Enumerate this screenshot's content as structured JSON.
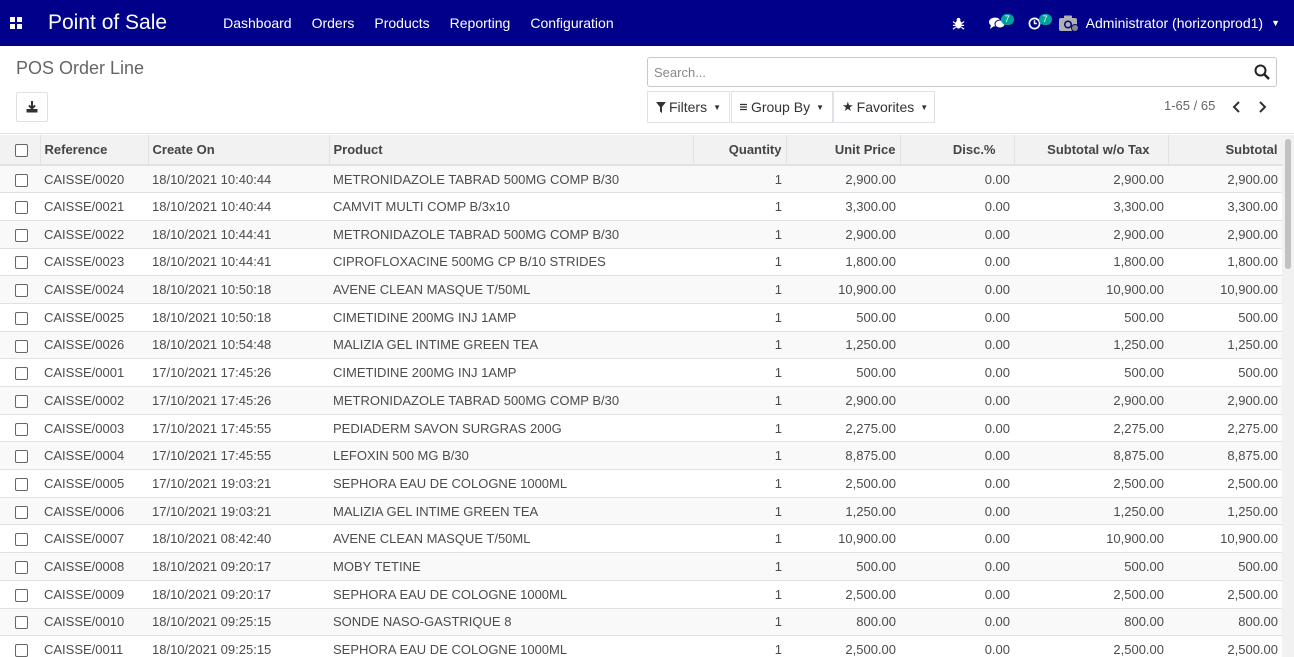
{
  "navbar": {
    "brand": "Point of Sale",
    "menu": [
      "Dashboard",
      "Orders",
      "Products",
      "Reporting",
      "Configuration"
    ],
    "messages_count": "7",
    "activities_count": "7",
    "user": "Administrator (horizonprod1)"
  },
  "control_panel": {
    "title": "POS Order Line",
    "search_placeholder": "Search...",
    "filters_label": "Filters",
    "groupby_label": "Group By",
    "favorites_label": "Favorites",
    "pager": "1-65 / 65"
  },
  "table": {
    "columns": [
      "Reference",
      "Create On",
      "Product",
      "Quantity",
      "Unit Price",
      "Disc.%",
      "Subtotal w/o Tax",
      "Subtotal"
    ],
    "rows": [
      [
        "CAISSE/0020",
        "18/10/2021 10:40:44",
        "METRONIDAZOLE TABRAD 500MG COMP B/30",
        "1",
        "2,900.00",
        "0.00",
        "2,900.00",
        "2,900.00"
      ],
      [
        "CAISSE/0021",
        "18/10/2021 10:40:44",
        "CAMVIT MULTI COMP B/3x10",
        "1",
        "3,300.00",
        "0.00",
        "3,300.00",
        "3,300.00"
      ],
      [
        "CAISSE/0022",
        "18/10/2021 10:44:41",
        "METRONIDAZOLE TABRAD 500MG COMP B/30",
        "1",
        "2,900.00",
        "0.00",
        "2,900.00",
        "2,900.00"
      ],
      [
        "CAISSE/0023",
        "18/10/2021 10:44:41",
        "CIPROFLOXACINE 500MG CP B/10 STRIDES",
        "1",
        "1,800.00",
        "0.00",
        "1,800.00",
        "1,800.00"
      ],
      [
        "CAISSE/0024",
        "18/10/2021 10:50:18",
        "AVENE CLEAN MASQUE T/50ML",
        "1",
        "10,900.00",
        "0.00",
        "10,900.00",
        "10,900.00"
      ],
      [
        "CAISSE/0025",
        "18/10/2021 10:50:18",
        "CIMETIDINE 200MG INJ 1AMP",
        "1",
        "500.00",
        "0.00",
        "500.00",
        "500.00"
      ],
      [
        "CAISSE/0026",
        "18/10/2021 10:54:48",
        "MALIZIA GEL INTIME GREEN TEA",
        "1",
        "1,250.00",
        "0.00",
        "1,250.00",
        "1,250.00"
      ],
      [
        "CAISSE/0001",
        "17/10/2021 17:45:26",
        "CIMETIDINE 200MG INJ 1AMP",
        "1",
        "500.00",
        "0.00",
        "500.00",
        "500.00"
      ],
      [
        "CAISSE/0002",
        "17/10/2021 17:45:26",
        "METRONIDAZOLE TABRAD 500MG COMP B/30",
        "1",
        "2,900.00",
        "0.00",
        "2,900.00",
        "2,900.00"
      ],
      [
        "CAISSE/0003",
        "17/10/2021 17:45:55",
        "PEDIADERM SAVON SURGRAS 200G",
        "1",
        "2,275.00",
        "0.00",
        "2,275.00",
        "2,275.00"
      ],
      [
        "CAISSE/0004",
        "17/10/2021 17:45:55",
        "LEFOXIN 500 MG B/30",
        "1",
        "8,875.00",
        "0.00",
        "8,875.00",
        "8,875.00"
      ],
      [
        "CAISSE/0005",
        "17/10/2021 19:03:21",
        "SEPHORA EAU DE COLOGNE 1000ML",
        "1",
        "2,500.00",
        "0.00",
        "2,500.00",
        "2,500.00"
      ],
      [
        "CAISSE/0006",
        "17/10/2021 19:03:21",
        "MALIZIA GEL INTIME GREEN TEA",
        "1",
        "1,250.00",
        "0.00",
        "1,250.00",
        "1,250.00"
      ],
      [
        "CAISSE/0007",
        "18/10/2021 08:42:40",
        "AVENE CLEAN MASQUE T/50ML",
        "1",
        "10,900.00",
        "0.00",
        "10,900.00",
        "10,900.00"
      ],
      [
        "CAISSE/0008",
        "18/10/2021 09:20:17",
        "MOBY TETINE",
        "1",
        "500.00",
        "0.00",
        "500.00",
        "500.00"
      ],
      [
        "CAISSE/0009",
        "18/10/2021 09:20:17",
        "SEPHORA EAU DE COLOGNE 1000ML",
        "1",
        "2,500.00",
        "0.00",
        "2,500.00",
        "2,500.00"
      ],
      [
        "CAISSE/0010",
        "18/10/2021 09:25:15",
        "SONDE NASO-GASTRIQUE 8",
        "1",
        "800.00",
        "0.00",
        "800.00",
        "800.00"
      ],
      [
        "CAISSE/0011",
        "18/10/2021 09:25:15",
        "SEPHORA EAU DE COLOGNE 1000ML",
        "1",
        "2,500.00",
        "0.00",
        "2,500.00",
        "2,500.00"
      ]
    ]
  },
  "colors": {
    "navbar": "#00008b",
    "badge": "#00a09d"
  }
}
